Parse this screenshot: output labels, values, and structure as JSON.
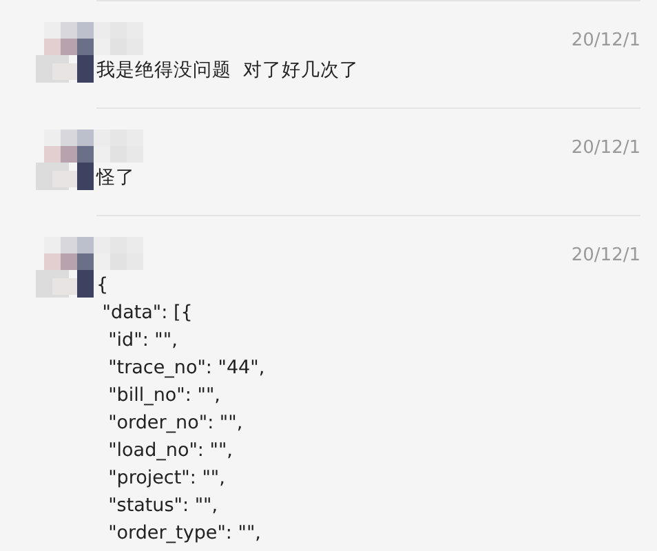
{
  "messages": [
    {
      "time": "20/12/1",
      "lines": [
        "我是绝得没问题  对了好几次了"
      ]
    },
    {
      "time": "20/12/1",
      "lines": [
        "怪了"
      ]
    },
    {
      "time": "20/12/1",
      "lines": [
        "{",
        " \"data\": [{",
        "  \"id\": \"\",",
        "  \"trace_no\": \"44\",",
        "  \"bill_no\": \"\",",
        "  \"order_no\": \"\",",
        "  \"load_no\": \"\",",
        "  \"project\": \"\",",
        "  \"status\": \"\",",
        "  \"order_type\": \"\","
      ]
    }
  ]
}
